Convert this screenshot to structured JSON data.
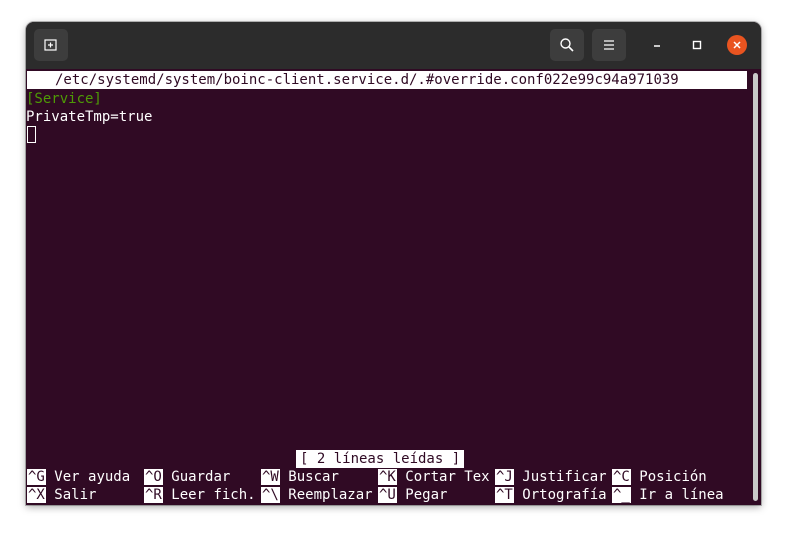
{
  "window": {
    "colors": {
      "background": "#300a24",
      "titlebar": "#2c2c2c",
      "close": "#e95420",
      "section": "#4e9a06"
    },
    "icons": {
      "new_tab": "new-tab-icon",
      "search": "search-icon",
      "menu": "hamburger-menu-icon",
      "minimize": "minimize-icon",
      "maximize": "maximize-icon",
      "close": "close-icon"
    }
  },
  "editor": {
    "file_path": "/etc/systemd/system/boinc-client.service.d/.#override.conf022e99c94a971039",
    "lines": [
      "[Service]",
      "PrivateTmp=true"
    ],
    "status": "[ 2 líneas leídas ]"
  },
  "shortcuts": {
    "row1": [
      {
        "key": "^G",
        "label": "Ver ayuda"
      },
      {
        "key": "^O",
        "label": "Guardar"
      },
      {
        "key": "^W",
        "label": "Buscar"
      },
      {
        "key": "^K",
        "label": "Cortar Tex"
      },
      {
        "key": "^J",
        "label": "Justificar"
      },
      {
        "key": "^C",
        "label": "Posición"
      }
    ],
    "row2": [
      {
        "key": "^X",
        "label": "Salir"
      },
      {
        "key": "^R",
        "label": "Leer fich."
      },
      {
        "key": "^\\",
        "label": "Reemplazar"
      },
      {
        "key": "^U",
        "label": "Pegar"
      },
      {
        "key": "^T",
        "label": "Ortografía"
      },
      {
        "key": "^_",
        "label": "Ir a línea"
      }
    ]
  }
}
